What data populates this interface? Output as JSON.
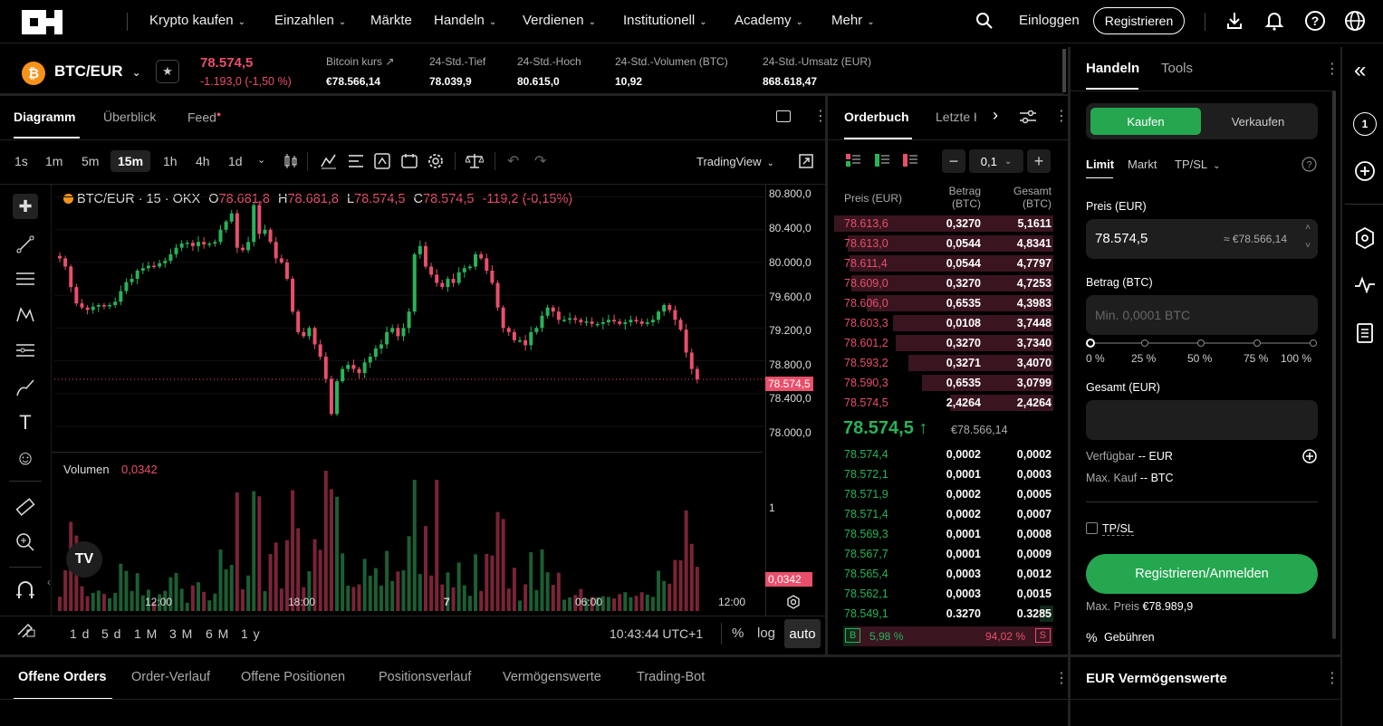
{
  "nav": {
    "items": [
      "Krypto kaufen",
      "Einzahlen",
      "Märkte",
      "Handeln",
      "Verdienen",
      "Institutionell",
      "Academy",
      "Mehr"
    ],
    "login": "Einloggen",
    "register": "Registrieren"
  },
  "ticker": {
    "pair": "BTC/EUR",
    "coin_glyph": "₿",
    "price": "78.574,5",
    "change": "-1.193,0 (-1,50 %)",
    "stats": [
      {
        "label": "Bitcoin kurs ↗",
        "value": "€78.566,14"
      },
      {
        "label": "24-Std.-Tief",
        "value": "78.039,9"
      },
      {
        "label": "24-Std.-Hoch",
        "value": "80.615,0"
      },
      {
        "label": "24-Std.-Volumen (BTC)",
        "value": "10,92"
      },
      {
        "label": "24-Std.-Umsatz (EUR)",
        "value": "868.618,47"
      }
    ]
  },
  "chart_tabs": [
    "Diagramm",
    "Überblick",
    "Feed"
  ],
  "timeframes": [
    "1s",
    "1m",
    "5m",
    "15m",
    "1h",
    "4h",
    "1d"
  ],
  "tradingview_label": "TradingView",
  "legend": {
    "symbol": "BTC/EUR · 15 · OKX",
    "o_label": "O",
    "o": "78.681,8",
    "h_label": "H",
    "h": "78.681,8",
    "l_label": "L",
    "l": "78.574,5",
    "c_label": "C",
    "c": "78.574,5",
    "chg": "-119,2 (-0,15%)"
  },
  "volume_label": "Volumen",
  "volume_value": "0,0342",
  "price_tag": "78.574,5",
  "volume_tag": "0,0342",
  "volume_axis_label": "1",
  "y_axis": [
    "80.800,0",
    "80.400,0",
    "80.000,0",
    "79.600,0",
    "79.200,0",
    "78.800,0",
    "78.400,0",
    "78.000,0"
  ],
  "x_axis": [
    "12:00",
    "18:00",
    "7",
    "06:00",
    "12:00"
  ],
  "ranges": [
    "1 d",
    "5 d",
    "1 M",
    "3 M",
    "6 M",
    "1 y"
  ],
  "clock": "10:43:44 UTC+1",
  "scale_opts": {
    "pct": "%",
    "log": "log",
    "auto": "auto"
  },
  "orderbook": {
    "tab": "Orderbuch",
    "tab2": "Letzte H",
    "step": "0,1",
    "col_price": "Preis (EUR)",
    "col_amount_1": "Betrag",
    "col_amount_2": "(BTC)",
    "col_total_1": "Gesamt",
    "col_total_2": "(BTC)",
    "asks": [
      {
        "p": "78.613,6",
        "a": "0,3270",
        "t": "5,1611",
        "d": 1.0
      },
      {
        "p": "78.613,0",
        "a": "0,0544",
        "t": "4,8341",
        "d": 0.94
      },
      {
        "p": "78.611,4",
        "a": "0,0544",
        "t": "4,7797",
        "d": 0.93
      },
      {
        "p": "78.609,0",
        "a": "0,3270",
        "t": "4,7253",
        "d": 0.92
      },
      {
        "p": "78.606,0",
        "a": "0,6535",
        "t": "4,3983",
        "d": 0.85
      },
      {
        "p": "78.603,3",
        "a": "0,0108",
        "t": "3,7448",
        "d": 0.73
      },
      {
        "p": "78.601,2",
        "a": "0,3270",
        "t": "3,7340",
        "d": 0.72
      },
      {
        "p": "78.593,2",
        "a": "0,3271",
        "t": "3,4070",
        "d": 0.66
      },
      {
        "p": "78.590,3",
        "a": "0,6535",
        "t": "3,0799",
        "d": 0.6
      },
      {
        "p": "78.574,5",
        "a": "2,4264",
        "t": "2,4264",
        "d": 0.47
      }
    ],
    "mid": "78.574,5 ↑",
    "mid_ref": "€78.566,14",
    "bids": [
      {
        "p": "78.574,4",
        "a": "0,0002",
        "t": "0,0002",
        "d": 0.0
      },
      {
        "p": "78.572,1",
        "a": "0,0001",
        "t": "0,0003",
        "d": 0.0
      },
      {
        "p": "78.571,9",
        "a": "0,0002",
        "t": "0,0005",
        "d": 0.0
      },
      {
        "p": "78.571,4",
        "a": "0,0002",
        "t": "0,0007",
        "d": 0.0
      },
      {
        "p": "78.569,3",
        "a": "0,0001",
        "t": "0,0008",
        "d": 0.0
      },
      {
        "p": "78.567,7",
        "a": "0,0001",
        "t": "0,0009",
        "d": 0.0
      },
      {
        "p": "78.565,4",
        "a": "0,0003",
        "t": "0,0012",
        "d": 0.0
      },
      {
        "p": "78.562,1",
        "a": "0,0003",
        "t": "0,0015",
        "d": 0.0
      },
      {
        "p": "78.549,1",
        "a": "0.3270",
        "t": "0.3285",
        "d": 0.06
      }
    ],
    "ratio_b": "B",
    "ratio_b_val": "5,98 %",
    "ratio_s_val": "94,02 %",
    "ratio_s": "S",
    "buy_fraction": 0.0598
  },
  "trade": {
    "tab_active": "Handeln",
    "tab2": "Tools",
    "buy": "Kaufen",
    "sell": "Verkaufen",
    "order_types": [
      "Limit",
      "Markt",
      "TP/SL"
    ],
    "price_label": "Preis (EUR)",
    "price_value": "78.574,5",
    "price_approx": "≈ €78.566,14",
    "amount_label": "Betrag (BTC)",
    "amount_placeholder": "Min. 0,0001 BTC",
    "slider_marks": [
      "0 %",
      "25 %",
      "50 %",
      "75 %",
      "100 %"
    ],
    "total_label": "Gesamt (EUR)",
    "available_label": "Verfügbar",
    "available_value": "-- EUR",
    "maxbuy_label": "Max. Kauf",
    "maxbuy_value": "-- BTC",
    "tpsl": "TP/SL",
    "cta": "Registrieren/Anmelden",
    "maxprice_label": "Max. Preis",
    "maxprice_value": "€78.989,9",
    "fees": "Gebühren"
  },
  "bottom": {
    "tabs": [
      "Offene Orders",
      "Order-Verlauf",
      "Offene Positionen",
      "Positionsverlauf",
      "Vermögenswerte",
      "Trading-Bot"
    ],
    "assets_title": "EUR Vermögenswerte"
  },
  "sidebar_badge": "1",
  "colors": {
    "up": "#29b358",
    "down": "#e94f6b",
    "buy_btn": "#25a750",
    "bg": "#000000"
  },
  "chart_data": {
    "type": "candlestick",
    "title": "BTC/EUR · 15 · OKX",
    "x_ticks": [
      "12:00",
      "18:00",
      "7",
      "06:00",
      "12:00"
    ],
    "ylim": [
      77900,
      80850
    ],
    "candles_close": [
      80050,
      79950,
      79700,
      79500,
      79450,
      79420,
      79460,
      79480,
      79470,
      79480,
      79520,
      79650,
      79760,
      79800,
      79900,
      79930,
      79960,
      79950,
      79990,
      80020,
      80100,
      80180,
      80230,
      80240,
      80200,
      80250,
      80220,
      80230,
      80250,
      80400,
      80500,
      80600,
      80180,
      80150,
      80250,
      80700,
      80350,
      80400,
      80250,
      80050,
      80000,
      79800,
      79400,
      79150,
      79100,
      79200,
      79000,
      78850,
      78580,
      78150,
      78550,
      78700,
      78750,
      78700,
      78650,
      78780,
      78850,
      78950,
      79000,
      79150,
      79200,
      79100,
      79200,
      79400,
      80100,
      80200,
      79950,
      79850,
      79750,
      79700,
      79800,
      79750,
      79880,
      79930,
      79950,
      80100,
      80050,
      79900,
      79750,
      79450,
      79200,
      79150,
      79050,
      79050,
      78990,
      79150,
      79200,
      79350,
      79450,
      79400,
      79300,
      79300,
      79320,
      79300,
      79270,
      79280,
      79250,
      79250,
      79270,
      79300,
      79280,
      79250,
      79270,
      79300,
      79280,
      79250,
      79270,
      79300,
      79400,
      79480,
      79420,
      79300,
      79180,
      78900,
      78700,
      78574
    ],
    "volume_axis_ticks": [
      "1"
    ],
    "volume_last": "0,0342"
  }
}
